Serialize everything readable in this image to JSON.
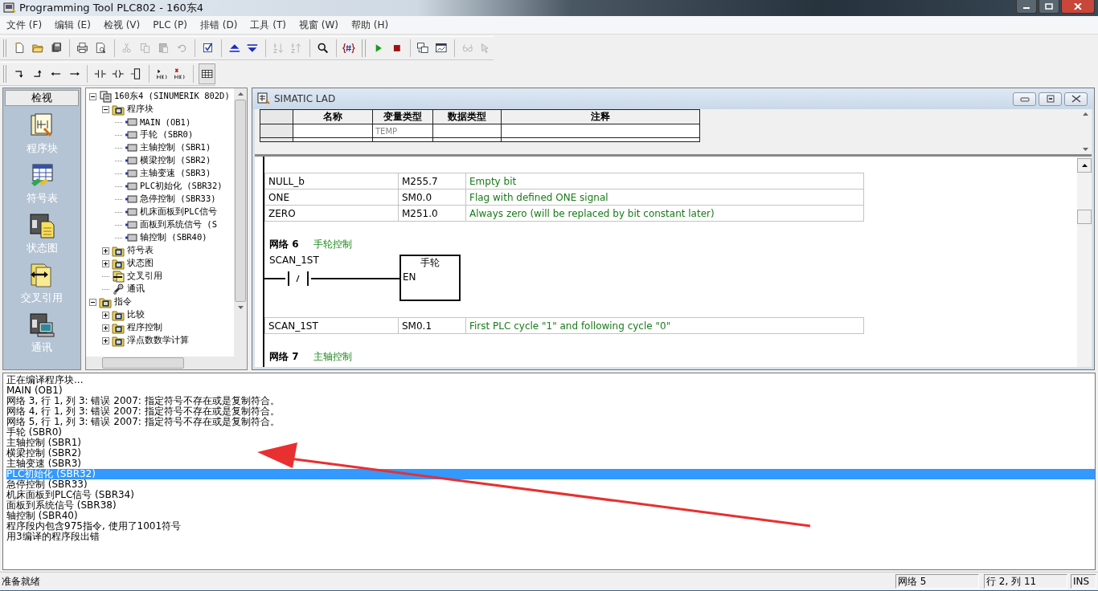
{
  "window": {
    "title": "Programming Tool PLC802 - 160东4"
  },
  "menu": [
    "文件 (F)",
    "编辑 (E)",
    "检视 (V)",
    "PLC (P)",
    "排错 (D)",
    "工具 (T)",
    "视窗 (W)",
    "帮助 (H)"
  ],
  "navigator": {
    "title": "检视",
    "items": [
      "程序块",
      "符号表",
      "状态图",
      "交叉引用",
      "通讯"
    ]
  },
  "tree": [
    {
      "label": "160东4 (SINUMERIK 802D)",
      "kind": "project",
      "expanded": true,
      "children": [
        {
          "label": "程序块",
          "kind": "folder",
          "expanded": true,
          "children": [
            {
              "label": "MAIN (OB1)",
              "kind": "block"
            },
            {
              "label": "手轮 (SBR0)",
              "kind": "block"
            },
            {
              "label": "主轴控制 (SBR1)",
              "kind": "block"
            },
            {
              "label": "横梁控制 (SBR2)",
              "kind": "block"
            },
            {
              "label": "主轴变速 (SBR3)",
              "kind": "block"
            },
            {
              "label": "PLC初始化 (SBR32)",
              "kind": "block"
            },
            {
              "label": "急停控制 (SBR33)",
              "kind": "block"
            },
            {
              "label": "机床面板到PLC信号",
              "kind": "block"
            },
            {
              "label": "面板到系统信号 (S",
              "kind": "block"
            },
            {
              "label": "轴控制 (SBR40)",
              "kind": "block"
            }
          ]
        },
        {
          "label": "符号表",
          "kind": "folder",
          "expanded": false
        },
        {
          "label": "状态图",
          "kind": "folder",
          "expanded": false
        },
        {
          "label": "交叉引用",
          "kind": "xref"
        },
        {
          "label": "通讯",
          "kind": "comm"
        }
      ]
    },
    {
      "label": "指令",
      "kind": "folder",
      "expanded": true,
      "children": [
        {
          "label": "比较",
          "kind": "folder",
          "expanded": false
        },
        {
          "label": "程序控制",
          "kind": "folder",
          "expanded": false
        },
        {
          "label": "浮点数数学计算",
          "kind": "folder",
          "expanded": false
        }
      ]
    }
  ],
  "editor": {
    "title": "SIMATIC LAD",
    "variable_table": {
      "columns": [
        "名称",
        "变量类型",
        "数据类型",
        "注释"
      ],
      "rows": [
        {
          "var_type": "TEMP"
        }
      ]
    },
    "symbols": [
      {
        "name": "NULL_b",
        "address": "M255.7",
        "comment": "Empty bit"
      },
      {
        "name": "ONE",
        "address": "SM0.0",
        "comment": "Flag with defined ONE signal"
      },
      {
        "name": "ZERO",
        "address": "M251.0",
        "comment": "Always zero (will be replaced by bit constant later)"
      }
    ],
    "networks": [
      {
        "number": "网络 6",
        "title": "手轮控制",
        "contact": "SCAN_1ST",
        "box": "手轮",
        "box_input": "EN",
        "symbols": [
          {
            "name": "SCAN_1ST",
            "address": "SM0.1",
            "comment": "First PLC cycle \"1\" and following cycle \"0\""
          }
        ]
      },
      {
        "number": "网络 7",
        "title": "主轴控制"
      }
    ]
  },
  "output": [
    {
      "text": "正在编译程序块...",
      "selected": false
    },
    {
      "text": "MAIN (OB1)",
      "selected": false
    },
    {
      "text": "网络 3, 行 1, 列 3: 错误 2007: 指定符号不存在或是复制符合。",
      "selected": false
    },
    {
      "text": "网络 4, 行 1, 列 3: 错误 2007: 指定符号不存在或是复制符合。",
      "selected": false
    },
    {
      "text": "网络 5, 行 1, 列 3: 错误 2007: 指定符号不存在或是复制符合。",
      "selected": false
    },
    {
      "text": "手轮 (SBR0)",
      "selected": false
    },
    {
      "text": "主轴控制 (SBR1)",
      "selected": false
    },
    {
      "text": "横梁控制 (SBR2)",
      "selected": false
    },
    {
      "text": "主轴变速 (SBR3)",
      "selected": false
    },
    {
      "text": "PLC初始化 (SBR32)",
      "selected": true
    },
    {
      "text": "急停控制 (SBR33)",
      "selected": false
    },
    {
      "text": "机床面板到PLC信号 (SBR34)",
      "selected": false
    },
    {
      "text": "面板到系统信号 (SBR38)",
      "selected": false
    },
    {
      "text": "轴控制 (SBR40)",
      "selected": false
    },
    {
      "text": "程序段内包含975指令, 使用了1001符号",
      "selected": false
    },
    {
      "text": "用3编译的程序段出错",
      "selected": false
    }
  ],
  "status_bar": {
    "message": "准备就绪",
    "network": "网络 5",
    "position": "行 2, 列 11",
    "mode": "INS"
  }
}
